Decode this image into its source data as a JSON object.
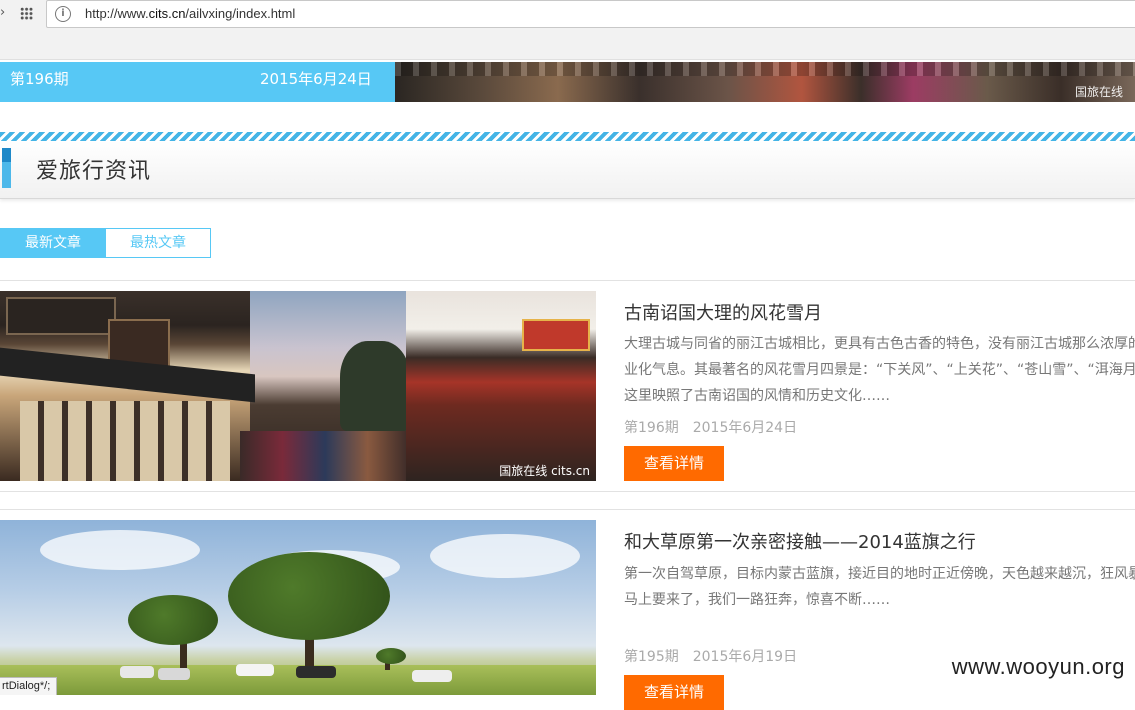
{
  "browser": {
    "url_prefix": "http://www.",
    "url_host": "cits.cn",
    "url_path": "/ailvxing/index.html"
  },
  "banner": {
    "issue": "第196期",
    "date": "2015年6月24日",
    "image_watermark": "国旅在线"
  },
  "section": {
    "title": "爱旅行资讯"
  },
  "tabs": [
    {
      "label": "最新文章",
      "active": true
    },
    {
      "label": "最热文章",
      "active": false
    }
  ],
  "articles": [
    {
      "title": "古南诏国大理的风花雪月",
      "summary": "大理古城与同省的丽江古城相比，更具有古色古香的特色，没有丽江古城那么浓厚的商业化气息。其最著名的风花雪月四景是：“下关风”、“上关花”、“苍山雪”、“洱海月”，这里映照了古南诏国的风情和历史文化……",
      "issue": "第196期",
      "date": "2015年6月24日",
      "button": "查看详情",
      "image_watermark": "国旅在线  cits.cn"
    },
    {
      "title": "和大草原第一次亲密接触——2014蓝旗之行",
      "summary": "第一次自驾草原，目标内蒙古蓝旗，接近目的地时正近傍晚，天色越来越沉，狂风暴雨马上要来了，我们一路狂奔，惊喜不断……",
      "issue": "第195期",
      "date": "2015年6月19日",
      "button": "查看详情"
    }
  ],
  "overlay": {
    "site_watermark": "www.wooyun.org",
    "status_tip": "rtDialog*/;"
  },
  "colors": {
    "accent_blue": "#57c8f5",
    "button_orange": "#ff6a00"
  }
}
